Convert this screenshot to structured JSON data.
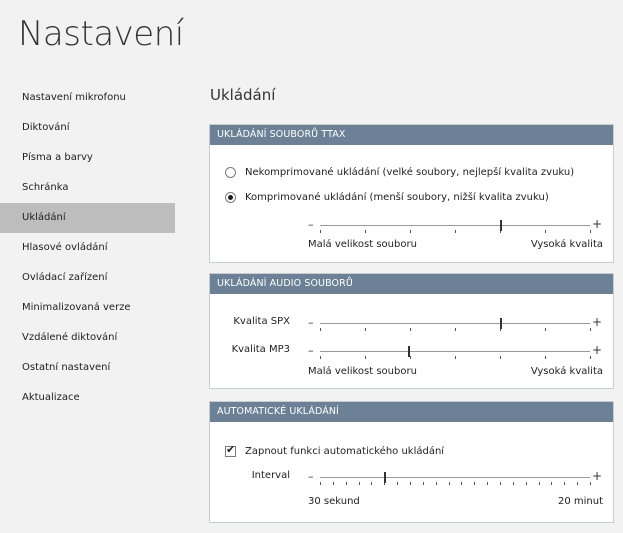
{
  "page_title": "Nastavení",
  "sidebar": {
    "items": [
      {
        "label": "Nastavení mikrofonu"
      },
      {
        "label": "Diktování"
      },
      {
        "label": "Písma a barvy"
      },
      {
        "label": "Schránka"
      },
      {
        "label": "Ukládání"
      },
      {
        "label": "Hlasové ovládání"
      },
      {
        "label": "Ovládací zařízení"
      },
      {
        "label": "Minimalizovaná verze"
      },
      {
        "label": "Vzdálené diktování"
      },
      {
        "label": "Ostatní nastavení"
      },
      {
        "label": "Aktualizace"
      }
    ],
    "active_index": 4
  },
  "section_title": "Ukládání",
  "panel_ttax": {
    "header": "UKLÁDÁNÍ SOUBORŮ TTAX",
    "options": [
      {
        "label": "Nekomprimované ukládání (velké soubory, nejlepší kvalita zvuku)",
        "checked": false
      },
      {
        "label": "Komprimované ukládání (menší soubory, nižší kvalita zvuku)",
        "checked": true
      }
    ],
    "slider": {
      "minus": "–",
      "plus": "+",
      "ticks": 7,
      "value_fraction": 0.67
    },
    "caption_left": "Malá velikost souboru",
    "caption_right": "Vysoká kvalita"
  },
  "panel_audio": {
    "header": "UKLÁDÁNÍ AUDIO SOUBORŮ",
    "sliders": [
      {
        "label": "Kvalita SPX",
        "minus": "–",
        "plus": "+",
        "ticks": 7,
        "value_fraction": 0.67
      },
      {
        "label": "Kvalita MP3",
        "minus": "–",
        "plus": "+",
        "ticks": 7,
        "value_fraction": 0.33
      }
    ],
    "caption_left": "Malá velikost souboru",
    "caption_right": "Vysoká kvalita"
  },
  "panel_auto": {
    "header": "AUTOMATICKÉ UKLÁDÁNÍ",
    "checkbox": {
      "label": "Zapnout funkci automatického ukládání",
      "checked": true,
      "mark": "✔"
    },
    "interval": {
      "label": "Interval",
      "minus": "–",
      "plus": "+",
      "ticks": 22,
      "value_fraction": 0.24
    },
    "caption_left": "30 sekund",
    "caption_right": "20 minut"
  }
}
